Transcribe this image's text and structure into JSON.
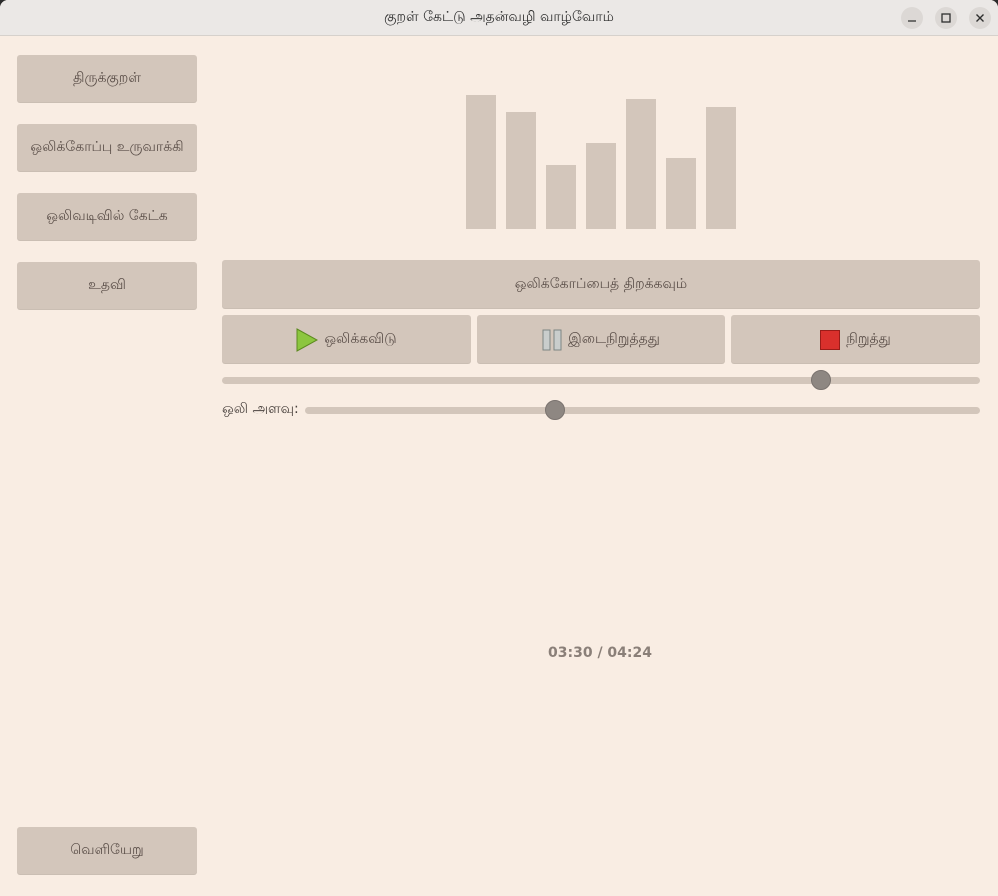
{
  "window": {
    "title": "குறள் கேட்டு அதன்வழி வாழ்வோம்"
  },
  "sidebar": {
    "items": [
      {
        "label": "திருக்குறள்"
      },
      {
        "label": "ஒலிக்கோப்பு உருவாக்கி"
      },
      {
        "label": "ஒலிவடிவில் கேட்க"
      },
      {
        "label": "உதவி"
      }
    ],
    "exit_label": "வெளியேறு"
  },
  "visualizer": {
    "levels": [
      1.0,
      0.87,
      0.48,
      0.64,
      0.97,
      0.53,
      0.91
    ]
  },
  "player": {
    "open_label": "ஒலிக்கோப்பைத் திறக்கவும்",
    "play_label": "ஒலிக்கவிடு",
    "pause_label": "இடைநிறுத்தது",
    "stop_label": "நிறுத்து",
    "progress_fraction": 0.79,
    "volume_label": "ஒலி அளவு:",
    "volume_fraction": 0.37,
    "time_display": "03:30 / 04:24"
  },
  "colors": {
    "background": "#f9ede3",
    "button": "#d3c6bb",
    "play_icon": "#8cc63f",
    "stop_icon": "#d9302c"
  }
}
